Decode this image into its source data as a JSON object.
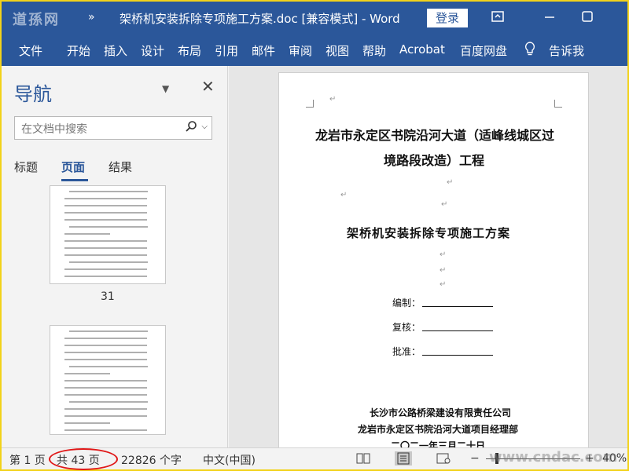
{
  "titlebar": {
    "logo": "道孫网",
    "more": "»",
    "title": "架桥机安装拆除专项施工方案.doc [兼容模式]  -  Word",
    "login": "登录"
  },
  "ribbon": {
    "tabs": [
      "文件",
      "开始",
      "插入",
      "设计",
      "布局",
      "引用",
      "邮件",
      "审阅",
      "视图",
      "帮助",
      "Acrobat",
      "百度网盘",
      "告诉我"
    ]
  },
  "nav": {
    "title": "导航",
    "search_placeholder": "在文档中搜索",
    "tabs": [
      "标题",
      "页面",
      "结果"
    ],
    "thumbs": [
      {
        "num": "31"
      }
    ]
  },
  "document": {
    "title_line1": "龙岩市永定区书院沿河大道（适峰线城区过",
    "title_line2": "境路段改造）工程",
    "subtitle": "架桥机安装拆除专项施工方案",
    "fields": [
      "编制：",
      "复核：",
      "批准："
    ],
    "org1": "长沙市公路桥梁建设有限责任公司",
    "org2": "龙岩市永定区书院沿河大道项目经理部",
    "date": "二〇二一年三月二十日"
  },
  "status": {
    "page": "第 1 页",
    "total": "共 43 页",
    "words": "22826 个字",
    "lang": "中文(中国)",
    "zoom": "40%"
  },
  "watermark": "www.cndac.com"
}
